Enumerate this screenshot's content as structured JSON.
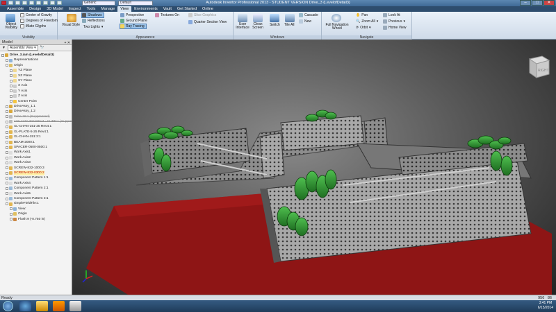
{
  "window": {
    "title": "Autodesk Inventor Professional 2013 - STUDENT VERSION  Drive_3 (LevelofDetail3)",
    "qat_selects": [
      "Generic",
      "Default"
    ]
  },
  "tabs": [
    "Assemble",
    "Design",
    "3D Model",
    "Inspect",
    "Tools",
    "Manage",
    "View",
    "Environments",
    "Vault",
    "Get Started",
    "Online"
  ],
  "active_tab": "View",
  "ribbon": {
    "visibility": {
      "label": "Visibility",
      "object_visibility": "Object Visibility",
      "center_of_gravity": "Center of Gravity",
      "degrees_of_freedom": "Degrees of Freedom",
      "ifate_glyphs": "iMate Glyphs"
    },
    "appearance": {
      "label": "Appearance",
      "visual_style": "Visual Style",
      "shadows": "Shadows",
      "reflections": "Reflections",
      "lighting": "Two Lights",
      "perspective": "Perspective",
      "ground_plane": "Ground Plane",
      "ray_tracing": "Ray Tracing",
      "textures_on": "Textures On",
      "slice_graphics": "Slice Graphics",
      "quarter_section": "Quarter Section View"
    },
    "windows": {
      "label": "Windows",
      "user_interface": "User Interface",
      "clean_screen": "Clean Screen",
      "switch": "Switch",
      "tile_all": "Tile All",
      "cascade": "Cascade",
      "new": "New"
    },
    "navigate": {
      "label": "Navigate",
      "full_nav_wheel": "Full Navigation Wheel",
      "pan": "Pan",
      "zoom_all": "Zoom All",
      "orbit": "Orbit",
      "look_at": "Look At",
      "previous": "Previous",
      "home_view": "Home View"
    }
  },
  "browser": {
    "title": "Model",
    "view": "Assembly View",
    "nodes": [
      {
        "label": "Drive_3.iam (LevelofDetail3)",
        "indent": 0,
        "icon": "#d9a83a",
        "bold": true
      },
      {
        "label": "Representations",
        "indent": 1,
        "icon": "#8fb4d8"
      },
      {
        "label": "Origin",
        "indent": 1,
        "icon": "#e0c060"
      },
      {
        "label": "YZ Plane",
        "indent": 2,
        "icon": "#f0d890"
      },
      {
        "label": "XZ Plane",
        "indent": 2,
        "icon": "#f0d890"
      },
      {
        "label": "XY Plane",
        "indent": 2,
        "icon": "#f0d890"
      },
      {
        "label": "X Axis",
        "indent": 2,
        "icon": "#cccccc"
      },
      {
        "label": "Y Axis",
        "indent": 2,
        "icon": "#cccccc"
      },
      {
        "label": "Z Axis",
        "indent": 2,
        "icon": "#cccccc"
      },
      {
        "label": "Center Point",
        "indent": 2,
        "icon": "#f5c542"
      },
      {
        "label": "DriveAssy_1:1",
        "indent": 1,
        "icon": "#d9a83a"
      },
      {
        "label": "DriveAssy_1:2",
        "indent": 1,
        "icon": "#d9a83a"
      },
      {
        "label": "Tube 16:1 (Suppressed)",
        "indent": 1,
        "icon": "#bbbbbb",
        "strike": true
      },
      {
        "label": "476-1177-300 REV4 - CUBE:1 (Suppressed)",
        "indent": 1,
        "icon": "#bbbbbb",
        "strike": true
      },
      {
        "label": "XL-CHAN-151-25 Rev4:1",
        "indent": 1,
        "icon": "#e2b650"
      },
      {
        "label": "XL-PLATE-5-25 Rev4:1",
        "indent": 1,
        "icon": "#e2b650"
      },
      {
        "label": "XL-CHAN-151:3:1",
        "indent": 1,
        "icon": "#e2b650"
      },
      {
        "label": "BEAM-2000:1",
        "indent": 1,
        "icon": "#e2b650"
      },
      {
        "label": "SPACER-0500-0500:1",
        "indent": 1,
        "icon": "#e2b650"
      },
      {
        "label": "Work Axis1",
        "indent": 1,
        "icon": "#dddddd"
      },
      {
        "label": "Work Axis2",
        "indent": 1,
        "icon": "#dddddd"
      },
      {
        "label": "Work Axis3",
        "indent": 1,
        "icon": "#dddddd"
      },
      {
        "label": "SCREW-832-1000:3",
        "indent": 1,
        "icon": "#e2b650"
      },
      {
        "label": "SCREW-832-0300:2",
        "indent": 1,
        "icon": "#e2b650",
        "highlight": true
      },
      {
        "label": "Component Pattern 1:1",
        "indent": 1,
        "icon": "#9bbbd9"
      },
      {
        "label": "Work Axis4",
        "indent": 1,
        "icon": "#dddddd"
      },
      {
        "label": "Component Pattern 2:1",
        "indent": 1,
        "icon": "#9bbbd9"
      },
      {
        "label": "Work Axis5",
        "indent": 1,
        "icon": "#dddddd"
      },
      {
        "label": "Component Pattern 3:1",
        "indent": 1,
        "icon": "#9bbbd9"
      },
      {
        "label": "simpleFieldTile:1",
        "indent": 1,
        "icon": "#e2b650"
      },
      {
        "label": "View:",
        "indent": 2,
        "icon": "#8fb4d8"
      },
      {
        "label": "Origin",
        "indent": 2,
        "icon": "#e0c060"
      },
      {
        "label": "Flush:9 (-0.750 in)",
        "indent": 2,
        "icon": "#cc8844"
      }
    ]
  },
  "viewcube": {
    "label": "RIGHT"
  },
  "status": {
    "text": "Ready",
    "coords": [
      "956",
      "86"
    ]
  },
  "clock": {
    "time": "3:41 PM",
    "date": "6/15/2014"
  }
}
